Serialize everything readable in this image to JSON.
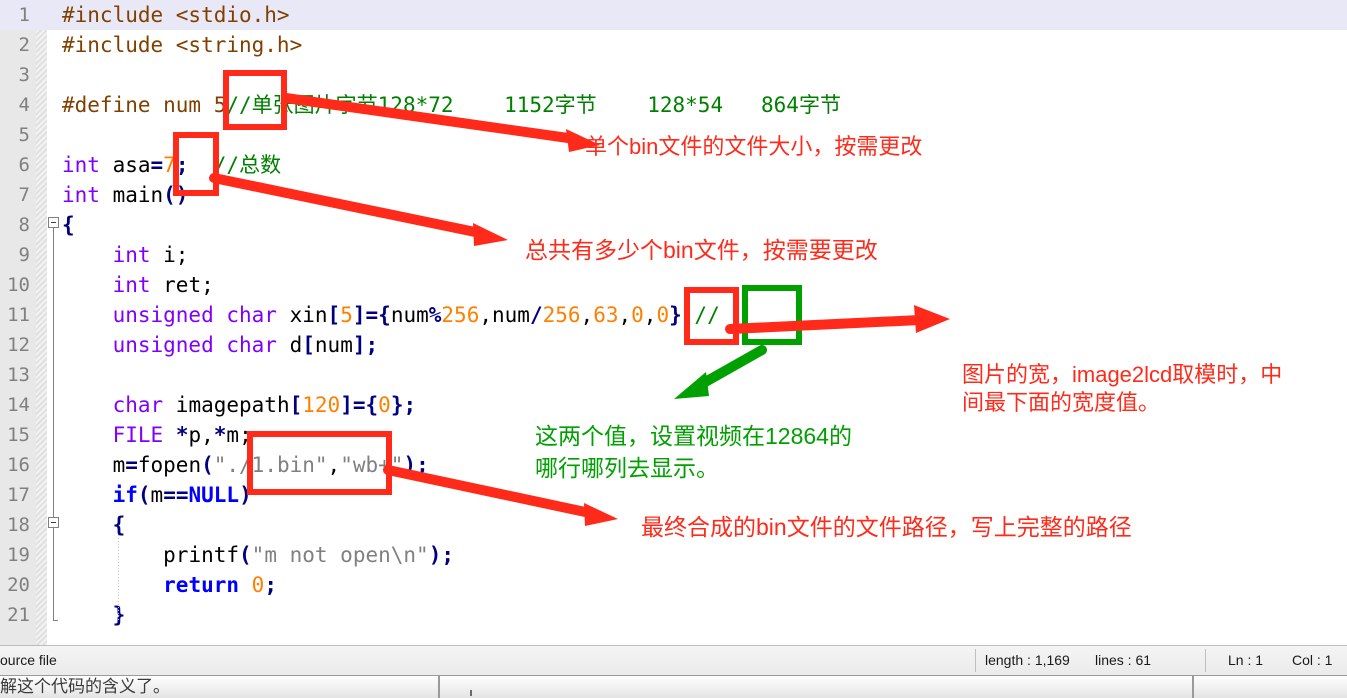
{
  "editor": {
    "lines": [
      {
        "n": "1",
        "current": true,
        "tokens": [
          {
            "t": "#include <stdio.h>",
            "c": "t-pre"
          }
        ]
      },
      {
        "n": "2",
        "current": false,
        "tokens": [
          {
            "t": "#include <string.h>",
            "c": "t-pre"
          }
        ]
      },
      {
        "n": "3",
        "current": false,
        "tokens": []
      },
      {
        "n": "4",
        "current": false,
        "tokens": [
          {
            "t": "#define num 5",
            "c": "t-pre"
          },
          {
            "t": "//单张图片字节128*72    1152字节    128*54   864字节",
            "c": "t-cmt"
          }
        ]
      },
      {
        "n": "5",
        "current": false,
        "tokens": []
      },
      {
        "n": "6",
        "current": false,
        "tokens": [
          {
            "t": "int",
            "c": "t-kw"
          },
          {
            "t": " asa",
            "c": "t-pln"
          },
          {
            "t": "=",
            "c": "t-op"
          },
          {
            "t": "7",
            "c": "t-num"
          },
          {
            "t": ";",
            "c": "t-op"
          },
          {
            "t": "  ",
            "c": "t-pln"
          },
          {
            "t": "//总数",
            "c": "t-cmt"
          }
        ]
      },
      {
        "n": "7",
        "current": false,
        "tokens": [
          {
            "t": "int",
            "c": "t-kw"
          },
          {
            "t": " main",
            "c": "t-pln"
          },
          {
            "t": "()",
            "c": "t-punc"
          }
        ]
      },
      {
        "n": "8",
        "current": false,
        "tokens": [
          {
            "t": "{",
            "c": "t-punc"
          }
        ]
      },
      {
        "n": "9",
        "current": false,
        "tokens": [
          {
            "t": "    ",
            "c": "t-pln"
          },
          {
            "t": "int",
            "c": "t-kw"
          },
          {
            "t": " i;",
            "c": "t-pln"
          }
        ]
      },
      {
        "n": "10",
        "current": false,
        "tokens": [
          {
            "t": "    ",
            "c": "t-pln"
          },
          {
            "t": "int",
            "c": "t-kw"
          },
          {
            "t": " ret;",
            "c": "t-pln"
          }
        ]
      },
      {
        "n": "11",
        "current": false,
        "tokens": [
          {
            "t": "    ",
            "c": "t-pln"
          },
          {
            "t": "unsigned char",
            "c": "t-kw"
          },
          {
            "t": " xin",
            "c": "t-pln"
          },
          {
            "t": "[",
            "c": "t-punc"
          },
          {
            "t": "5",
            "c": "t-num"
          },
          {
            "t": "]",
            "c": "t-punc"
          },
          {
            "t": "=",
            "c": "t-op"
          },
          {
            "t": "{",
            "c": "t-punc"
          },
          {
            "t": "num",
            "c": "t-pln"
          },
          {
            "t": "%",
            "c": "t-op"
          },
          {
            "t": "256",
            "c": "t-num"
          },
          {
            "t": ",",
            "c": "t-pln"
          },
          {
            "t": "num",
            "c": "t-pln"
          },
          {
            "t": "/",
            "c": "t-op"
          },
          {
            "t": "256",
            "c": "t-num"
          },
          {
            "t": ",",
            "c": "t-pln"
          },
          {
            "t": "63",
            "c": "t-num"
          },
          {
            "t": ",",
            "c": "t-pln"
          },
          {
            "t": "0",
            "c": "t-num"
          },
          {
            "t": ",",
            "c": "t-pln"
          },
          {
            "t": "0",
            "c": "t-num"
          },
          {
            "t": "}",
            "c": "t-punc"
          },
          {
            "t": ";",
            "c": "t-op"
          },
          {
            "t": "//",
            "c": "t-cmt"
          }
        ]
      },
      {
        "n": "12",
        "current": false,
        "tokens": [
          {
            "t": "    ",
            "c": "t-pln"
          },
          {
            "t": "unsigned char",
            "c": "t-kw"
          },
          {
            "t": " d",
            "c": "t-pln"
          },
          {
            "t": "[",
            "c": "t-punc"
          },
          {
            "t": "num",
            "c": "t-pln"
          },
          {
            "t": "]",
            "c": "t-punc"
          },
          {
            "t": ";",
            "c": "t-op"
          }
        ]
      },
      {
        "n": "13",
        "current": false,
        "tokens": []
      },
      {
        "n": "14",
        "current": false,
        "tokens": [
          {
            "t": "    ",
            "c": "t-pln"
          },
          {
            "t": "char",
            "c": "t-kw"
          },
          {
            "t": " imagepath",
            "c": "t-pln"
          },
          {
            "t": "[",
            "c": "t-punc"
          },
          {
            "t": "120",
            "c": "t-num"
          },
          {
            "t": "]",
            "c": "t-punc"
          },
          {
            "t": "=",
            "c": "t-op"
          },
          {
            "t": "{",
            "c": "t-punc"
          },
          {
            "t": "0",
            "c": "t-num"
          },
          {
            "t": "}",
            "c": "t-punc"
          },
          {
            "t": ";",
            "c": "t-op"
          }
        ]
      },
      {
        "n": "15",
        "current": false,
        "tokens": [
          {
            "t": "    ",
            "c": "t-pln"
          },
          {
            "t": "FILE",
            "c": "t-kw"
          },
          {
            "t": " ",
            "c": "t-pln"
          },
          {
            "t": "*",
            "c": "t-op"
          },
          {
            "t": "p,",
            "c": "t-pln"
          },
          {
            "t": "*",
            "c": "t-op"
          },
          {
            "t": "m;",
            "c": "t-pln"
          }
        ]
      },
      {
        "n": "16",
        "current": false,
        "tokens": [
          {
            "t": "    m",
            "c": "t-pln"
          },
          {
            "t": "=",
            "c": "t-op"
          },
          {
            "t": "fopen",
            "c": "t-pln"
          },
          {
            "t": "(",
            "c": "t-punc"
          },
          {
            "t": "\"./1.bin\"",
            "c": "t-str"
          },
          {
            "t": ",",
            "c": "t-pln"
          },
          {
            "t": "\"wb+\"",
            "c": "t-str"
          },
          {
            "t": ")",
            "c": "t-punc"
          },
          {
            "t": ";",
            "c": "t-op"
          }
        ]
      },
      {
        "n": "17",
        "current": false,
        "tokens": [
          {
            "t": "    ",
            "c": "t-pln"
          },
          {
            "t": "if",
            "c": "t-kw2"
          },
          {
            "t": "(",
            "c": "t-punc"
          },
          {
            "t": "m",
            "c": "t-pln"
          },
          {
            "t": "==",
            "c": "t-op"
          },
          {
            "t": "NULL",
            "c": "t-kw2"
          },
          {
            "t": ")",
            "c": "t-punc"
          }
        ]
      },
      {
        "n": "18",
        "current": false,
        "tokens": [
          {
            "t": "    ",
            "c": "t-pln"
          },
          {
            "t": "{",
            "c": "t-punc"
          }
        ]
      },
      {
        "n": "19",
        "current": false,
        "tokens": [
          {
            "t": "        ",
            "c": "t-pln"
          },
          {
            "t": "printf",
            "c": "t-pln"
          },
          {
            "t": "(",
            "c": "t-punc"
          },
          {
            "t": "\"m not open\\n\"",
            "c": "t-str"
          },
          {
            "t": ")",
            "c": "t-punc"
          },
          {
            "t": ";",
            "c": "t-op"
          }
        ]
      },
      {
        "n": "20",
        "current": false,
        "tokens": [
          {
            "t": "        ",
            "c": "t-pln"
          },
          {
            "t": "return",
            "c": "t-kw2"
          },
          {
            "t": " ",
            "c": "t-pln"
          },
          {
            "t": "0",
            "c": "t-num"
          },
          {
            "t": ";",
            "c": "t-op"
          }
        ]
      },
      {
        "n": "21",
        "current": false,
        "tokens": [
          {
            "t": "    ",
            "c": "t-pln"
          },
          {
            "t": "}",
            "c": "t-punc"
          }
        ]
      }
    ]
  },
  "annotations": {
    "note_filesize": "单个bin文件的文件大小，按需更改",
    "note_filecount": "总共有多少个bin文件，按需要更改",
    "note_width_l1": "图片的宽，image2lcd取模时，中",
    "note_width_l2": "间最下面的宽度值。",
    "note_position_l1": "这两个值，设置视频在12864的",
    "note_position_l2": "哪行哪列去显示。",
    "note_path": "最终合成的bin文件的文件路径，写上完整的路径",
    "colors": {
      "red": "#ff2a1a",
      "green": "#00a000"
    }
  },
  "statusbar": {
    "doc_type": "ource file",
    "length": "length : 1,169",
    "lines": "lines : 61",
    "ln": "Ln : 1",
    "col": "Col : 1"
  },
  "bottom": {
    "clipped_text": "解这个代码的含义了。"
  }
}
